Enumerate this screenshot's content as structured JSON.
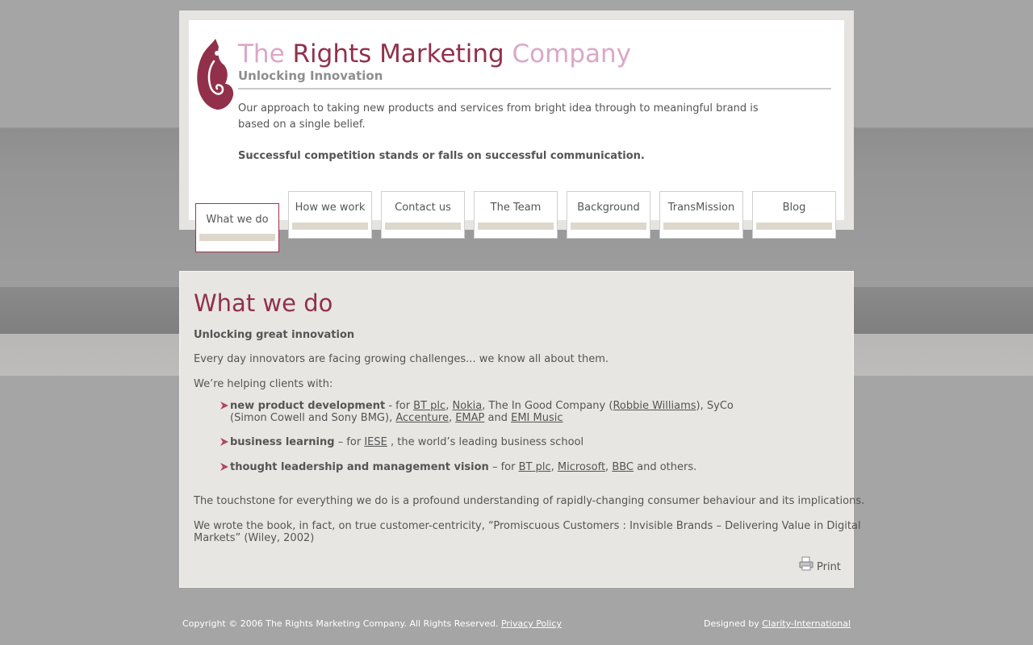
{
  "brand": {
    "part1": "The ",
    "part2": "Rights Marketing",
    "part3": " Company",
    "tagline": "Unlocking Innovation",
    "logo_icon": "hook-pendant-logo",
    "colors": {
      "accent": "#92304b",
      "light": "#dca6c8"
    }
  },
  "intro": {
    "text": "Our approach to taking new products and services from bright idea through to meaningful brand is based on a single belief.",
    "strong": "Successful competition stands or falls on successful communication."
  },
  "nav": {
    "tabs": [
      {
        "label": "What we do",
        "active": true
      },
      {
        "label": "How we work",
        "active": false
      },
      {
        "label": "Contact us",
        "active": false
      },
      {
        "label": "The Team",
        "active": false
      },
      {
        "label": "Background",
        "active": false
      },
      {
        "label": "TransMission",
        "active": false
      },
      {
        "label": "Blog",
        "active": false
      }
    ]
  },
  "main": {
    "title": "What we do",
    "subtitle": "Unlocking great innovation",
    "p1": "Every day innovators are facing growing challenges... we know all about them.",
    "p2": "We’re helping clients with:",
    "b1": {
      "strong": "new product development",
      "t1": " - for ",
      "l1": "BT plc",
      "t2": ", ",
      "l2": "Nokia",
      "t3": ", The In Good Company (",
      "l3": "Robbie Williams",
      "t4": "), SyCo",
      "t5": "(Simon Cowell and Sony BMG), ",
      "l4": "Accenture",
      "t6": ", ",
      "l5": "EMAP",
      "t7": " and ",
      "l6": "EMI Music"
    },
    "b2": {
      "strong": "business learning",
      "t1": " – for ",
      "l1": "IESE",
      "t2": " , the world’s leading business school"
    },
    "b3": {
      "strong": "thought leadership and management vision",
      "t1": " – for ",
      "l1": "BT plc",
      "t2": ", ",
      "l2": "Microsoft",
      "t3": ", ",
      "l3": "BBC",
      "t4": " and others."
    },
    "p3": "The touchstone for everything we do is a profound understanding of rapidly-changing consumer behaviour and its implications.",
    "p4a": "We wrote the book, in fact, on true customer-centricity, “Promiscuous Customers : Invisible Brands – Delivering Value in Digital",
    "p4b": "Markets” (Wiley, 2002)",
    "print_label": "Print",
    "print_icon": "printer-icon",
    "bullet_icon": "arrow-bullet-icon"
  },
  "footer": {
    "copyright": "Copyright © 2006 The Rights Marketing Company. All Rights Reserved. ",
    "privacy": "Privacy Policy",
    "designed_by": "Designed by ",
    "designer": "Clarity-International"
  }
}
